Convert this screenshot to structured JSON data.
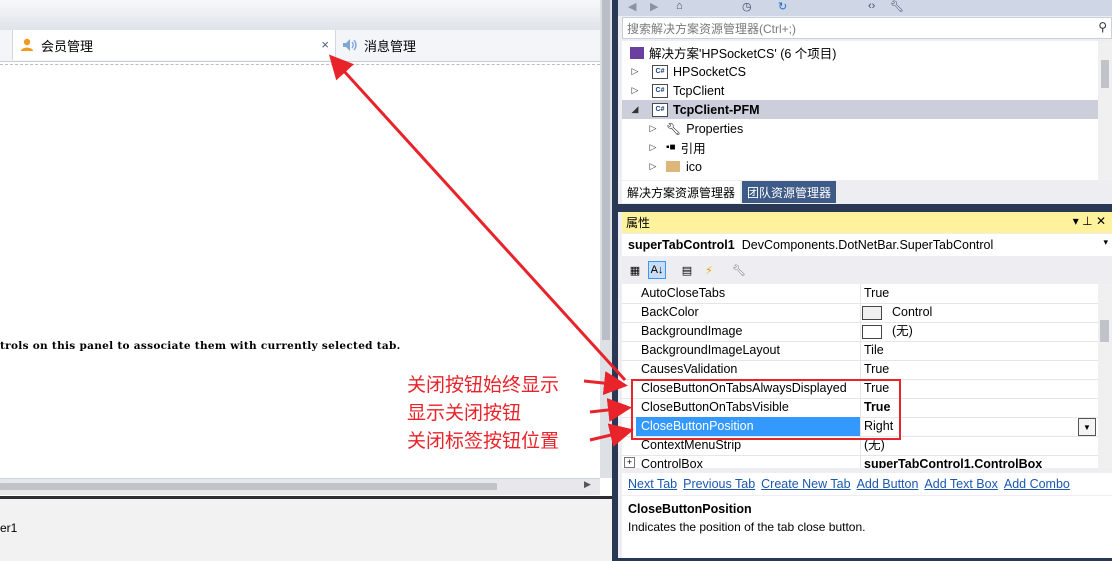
{
  "designer": {
    "tabs": [
      {
        "label": "会员管理",
        "close": "×"
      },
      {
        "label": "消息管理"
      }
    ],
    "hint_text": "trols on this panel to associate them with currently selected tab.",
    "tray_text": "er1"
  },
  "solution_explorer": {
    "search_placeholder": "搜索解决方案资源管理器(Ctrl+;)",
    "tree": [
      {
        "label": "解决方案'HPSocketCS' (6 个项目)",
        "kind": "solution"
      },
      {
        "label": "HPSocketCS",
        "kind": "project"
      },
      {
        "label": "TcpClient",
        "kind": "project"
      },
      {
        "label": "TcpClient-PFM",
        "kind": "project",
        "selected": true
      },
      {
        "label": "Properties",
        "kind": "properties"
      },
      {
        "label": "引用",
        "kind": "references"
      },
      {
        "label": "ico",
        "kind": "folder"
      }
    ],
    "tabs": [
      "解决方案资源管理器",
      "团队资源管理器"
    ]
  },
  "properties": {
    "title": "属性",
    "pin": "▾ ⊥ ✕",
    "object_name": "superTabControl1",
    "object_type": "DevComponents.DotNetBar.SuperTabControl",
    "rows": [
      {
        "name": "AutoCloseTabs",
        "value": "True"
      },
      {
        "name": "BackColor",
        "value": "Control",
        "swatch": true
      },
      {
        "name": "BackgroundImage",
        "value": "(无)",
        "swatch": true
      },
      {
        "name": "BackgroundImageLayout",
        "value": "Tile"
      },
      {
        "name": "CausesValidation",
        "value": "True"
      },
      {
        "name": "CloseButtonOnTabsAlwaysDisplayed",
        "value": "True"
      },
      {
        "name": "CloseButtonOnTabsVisible",
        "value": "True",
        "bold": true
      },
      {
        "name": "CloseButtonPosition",
        "value": "Right",
        "selected": true
      },
      {
        "name": "ContextMenuStrip",
        "value": "(无)"
      },
      {
        "name": "ControlBox",
        "value": "superTabControl1.ControlBox",
        "bold": true,
        "expandable": true
      }
    ],
    "commands": [
      "Next Tab",
      "Previous Tab",
      "Create New Tab",
      "Add Button",
      "Add Text Box",
      "Add Combo"
    ],
    "description_title": "CloseButtonPosition",
    "description_text": "Indicates the position of the tab close button."
  },
  "annotations": [
    "关闭按钮始终显示",
    "显示关闭按钮",
    "关闭标签按钮位置"
  ],
  "colors": {
    "annotation_red": "#e8232a",
    "selection_blue": "#3399ff",
    "properties_header": "#fff29d",
    "ide_frame": "#293955"
  }
}
